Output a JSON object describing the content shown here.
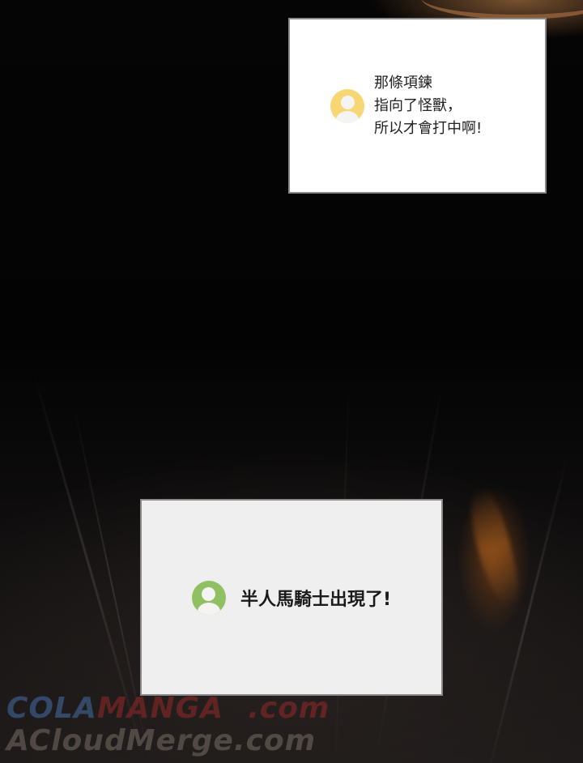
{
  "panels": {
    "top": {
      "lines": [
        "那條項鍊",
        "指向了怪獸，",
        "所以才會打中啊!"
      ]
    },
    "bottom": {
      "text": "半人馬騎士出現了!"
    }
  },
  "watermark": {
    "line1_a": "COLA",
    "line1_b": "MANGA",
    "line1_c": ".com",
    "line2": "ACloudMerge.com"
  },
  "colors": {
    "avatar_top": "#f7d774",
    "avatar_bottom": "#8fc163"
  },
  "icons": {
    "avatar_top": "user-avatar-icon",
    "avatar_bottom": "user-avatar-icon"
  }
}
